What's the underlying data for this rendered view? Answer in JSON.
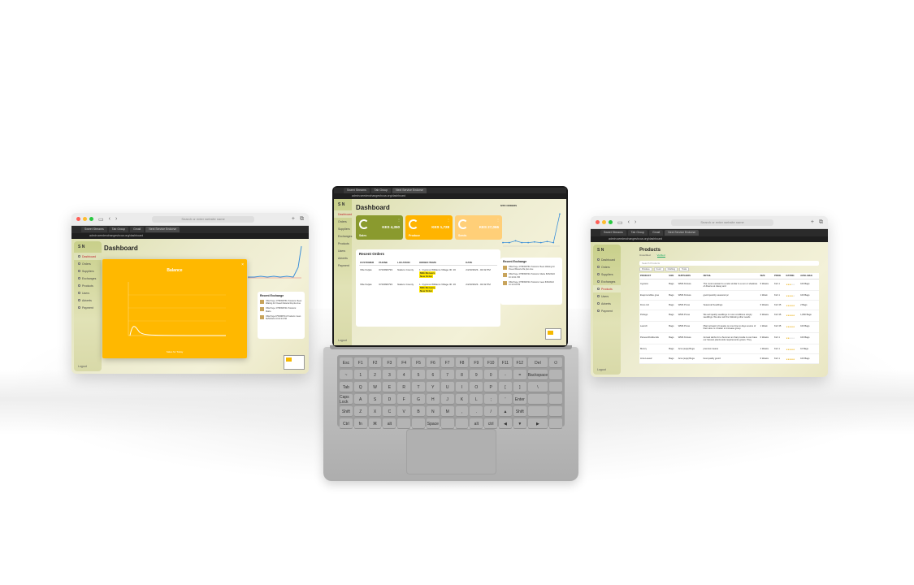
{
  "browser": {
    "url_placeholder": "Search or enter website name",
    "tab_labels": [
      "Sweet Streams",
      "Tab Group",
      "Gmail",
      "Next Service Endorse"
    ],
    "address": "admin.seedexchangeshcoa.org/dashboard"
  },
  "sidebar": {
    "logo": "S N",
    "items": [
      "Dashboard",
      "Orders",
      "Suppliers",
      "Exchanges",
      "Products",
      "Users",
      "Adverts",
      "Payment"
    ],
    "logout": "Logout"
  },
  "left_window": {
    "title": "Dashboard",
    "modal_title": "Balance",
    "modal_footer": "Sales for Today",
    "exchange_title": "Recent Exchange",
    "exchange_items": [
      "Offer/Kuje, 0758398751 Products: Bean Waiting for Oseed Meteria Ra plus due",
      "Offer/Kuje, 0758398741 Products: Maize",
      "Offer/Kuje 0758398741 Products: bean 8/25/2022 10:10:04 PM"
    ]
  },
  "center_window": {
    "title": "Dashboard",
    "cards": [
      {
        "label": "Sales",
        "value": "KES 4,350",
        "color": "#8a9a2e"
      },
      {
        "label": "Produce",
        "value": "KES 1,728",
        "color": "#ffb400"
      },
      {
        "label": "Seeds",
        "value": "KES 27,066",
        "color": "#ffcf78"
      }
    ],
    "orders_title": "Recent Orders",
    "orders_columns": [
      "CUSTOMER",
      "PHONE",
      "LOCATION",
      "ORDER ITEMS",
      "DATE"
    ],
    "orders_rows": [
      {
        "customer": "Ville Kuljas",
        "phone": "0723996793",
        "location": "Nakuru County",
        "items": "1. Cypress Williams Village ID: 16",
        "badge": "Milk Mereeru",
        "status": "New Order",
        "date": "24/10/2023 - 02:32 PM"
      },
      {
        "customer": "Ville Kuljas",
        "phone": "0723996793",
        "location": "Nakuru County",
        "items": "1. Cypress Williams Village ID: 16",
        "badge": "Milk Mereeru",
        "status": "New Order",
        "date": "24/10/2023 - 02:32 PM"
      }
    ],
    "chart_label": "MTD ORDERS",
    "exchange_title": "Recent Exchange",
    "exchange_items": [
      "Offer/Kuje, 0758398751 Products: Bean Waiting for Oseed Meteria Ra plus due",
      "Offer/Kuje, 0758398741 Products: Maize 8/25/2022 10:10:11 PM",
      "Offer/Kuje, 0758398741 Products: bean 8/25/2022 10:10:04 PM"
    ],
    "logout": "Logout"
  },
  "right_window": {
    "title": "Products",
    "tabs": [
      "Unverified",
      "Verified"
    ],
    "search_placeholder": "Search Products",
    "chips": [
      "Produce",
      "Food",
      "Clothing",
      "Tools"
    ],
    "columns": [
      "PRODUCT",
      "SIZE",
      "SUPPLIERS",
      "DETAIL",
      "SIZE",
      "PRICE",
      "RATING",
      "AVAILABLE"
    ],
    "rows": [
      {
        "product": "Cypress",
        "size": "Bags",
        "supplier": "WMS Kimiwe",
        "detail": "The most resistant to a ratio similar to a sun or shadows of diverse at classy and",
        "qty": "6 Weeks",
        "price": "Ksh 1",
        "rating": 3,
        "avail": "100 Bags"
      },
      {
        "product": "Evapmunditsu grue",
        "size": "Bags",
        "supplier": "WMS Kimiwe",
        "detail": "good quantity seasonal pc",
        "qty": "1 Week",
        "price": "Ksh 1",
        "rating": 4,
        "avail": "100 Bags"
      },
      {
        "product": "Ficus ind",
        "size": "Bags",
        "supplier": "WMS Prune",
        "detail": "Seasonal Seedlings",
        "qty": "6 Weeks",
        "price": "Ksh 35",
        "rating": 5,
        "avail": "2 Bags"
      },
      {
        "product": "Podugo",
        "size": "Bags",
        "supplier": "WMS Prune",
        "detail": "We sell quality seedlings in most conditions simply seedlings. We also sell the following other seeds",
        "qty": "6 Weeks",
        "price": "Ksh 35",
        "rating": 5,
        "avail": "1,800 Bags"
      },
      {
        "product": "Launch",
        "size": "Bags",
        "supplier": "WMS Prune",
        "detail": "Plant at least 4-6 weeks on one time to days source of their slow. Is it better to increase group",
        "qty": "1 Week",
        "price": "Ksh 35",
        "rating": 5,
        "avail": "100 Bags"
      },
      {
        "product": "Persea Dbotilsculis",
        "size": "Bags",
        "supplier": "WMS Kimiwe",
        "detail": "Annual Herbs for a Summer an that provide to can have our harvest plants wide requirements grows. They",
        "qty": "6 Weeks",
        "price": "Ksh 1",
        "rating": 2,
        "avail": "100 Bags"
      },
      {
        "product": "Moncy",
        "size": "Bags",
        "supplier": "Arva (soja) Boga",
        "detail": "premium keane",
        "qty": "1 Weeks",
        "price": "Ksh 1",
        "rating": 5,
        "avail": "10 Bags"
      },
      {
        "product": "Arca Leseaf",
        "size": "Bags",
        "supplier": "Arva (soja) Boga",
        "detail": "best quality gourd",
        "qty": "6 Weeks",
        "price": "Ksh 1",
        "rating": 5,
        "avail": "100 Bags"
      }
    ]
  },
  "keyboard": {
    "rows": [
      [
        "Esc",
        "F1",
        "F2",
        "F3",
        "F4",
        "F5",
        "F6",
        "F7",
        "F8",
        "F9",
        "F10",
        "F11",
        "F12",
        "Del",
        "⏻"
      ],
      [
        "~",
        "1",
        "2",
        "3",
        "4",
        "5",
        "6",
        "7",
        "8",
        "9",
        "0",
        "-",
        "=",
        "Backspace",
        ""
      ],
      [
        "Tab",
        "Q",
        "W",
        "E",
        "R",
        "T",
        "Y",
        "U",
        "I",
        "O",
        "P",
        "[",
        "]",
        "\\",
        ""
      ],
      [
        "Caps Lock",
        "A",
        "S",
        "D",
        "F",
        "G",
        "H",
        "J",
        "K",
        "L",
        ";",
        "'",
        "Enter",
        "",
        ""
      ],
      [
        "Shift",
        "Z",
        "X",
        "C",
        "V",
        "B",
        "N",
        "M",
        ",",
        ".",
        "/",
        "▲",
        "Shift",
        "",
        ""
      ],
      [
        "Ctrl",
        "fn",
        "⌘",
        "alt",
        "",
        "",
        "Space",
        "",
        "",
        "alt",
        "ctrl",
        "◀",
        "▼",
        "▶",
        ""
      ]
    ]
  },
  "chart_data": {
    "type": "line",
    "x": [
      1,
      2,
      3,
      4,
      5,
      6,
      7,
      8,
      9,
      10
    ],
    "series": [
      {
        "values": [
          1,
          1,
          1.5,
          1,
          1,
          1.2,
          1,
          1.3,
          1,
          9
        ]
      }
    ],
    "ylim": [
      0,
      10
    ]
  }
}
